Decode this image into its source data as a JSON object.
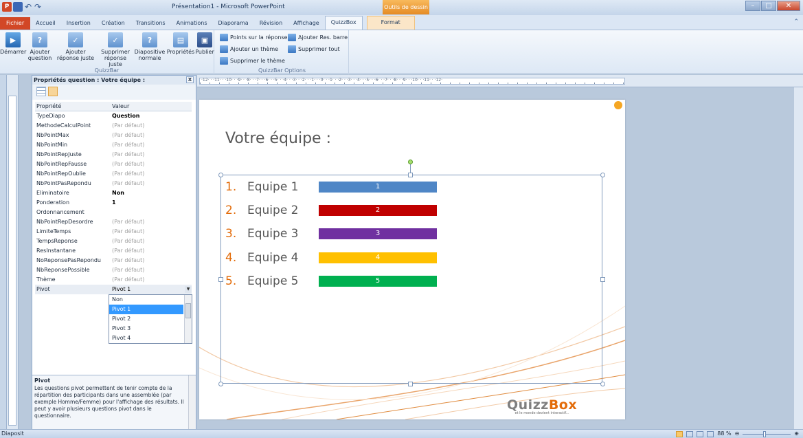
{
  "window": {
    "title": "Présentation1 - Microsoft PowerPoint",
    "contextual_tools": "Outils de dessin"
  },
  "ribbon_tabs": [
    {
      "label": "Fichier"
    },
    {
      "label": "Accueil"
    },
    {
      "label": "Insertion"
    },
    {
      "label": "Création"
    },
    {
      "label": "Transitions"
    },
    {
      "label": "Animations"
    },
    {
      "label": "Diaporama"
    },
    {
      "label": "Révision"
    },
    {
      "label": "Affichage"
    },
    {
      "label": "QuizzBox"
    },
    {
      "label": "Format"
    }
  ],
  "quizzbar": {
    "group_label": "QuizzBar",
    "buttons": [
      {
        "label": "Démarrer"
      },
      {
        "label": "Ajouter question"
      },
      {
        "label": "Ajouter réponse juste"
      },
      {
        "label": "Supprimer réponse juste"
      },
      {
        "label": "Diapositive normale"
      },
      {
        "label": "Propriétés"
      },
      {
        "label": "Publier"
      }
    ]
  },
  "quizzbar_options": {
    "group_label": "QuizzBar Options",
    "buttons": [
      {
        "label": "Points sur la réponse"
      },
      {
        "label": "Ajouter Res. barre"
      },
      {
        "label": "Ajouter un thème"
      },
      {
        "label": "Supprimer tout"
      },
      {
        "label": "Supprimer le thème"
      }
    ]
  },
  "properties_pane": {
    "title": "Propriétés question : Votre équipe :",
    "close_label": "X",
    "header": {
      "key": "Propriété",
      "value": "Valeur"
    },
    "rows": [
      {
        "key": "TypeDiapo",
        "value": "Question"
      },
      {
        "key": "MethodeCalculPoint",
        "value": "(Par défaut)"
      },
      {
        "key": "NbPointMax",
        "value": "(Par défaut)"
      },
      {
        "key": "NbPointMin",
        "value": "(Par défaut)"
      },
      {
        "key": "NbPointRepJuste",
        "value": "(Par défaut)"
      },
      {
        "key": "NbPointRepFausse",
        "value": "(Par défaut)"
      },
      {
        "key": "NbPointRepOublie",
        "value": "(Par défaut)"
      },
      {
        "key": "NbPointPasRepondu",
        "value": "(Par défaut)"
      },
      {
        "key": "Eliminatoire",
        "value": "Non"
      },
      {
        "key": "Ponderation",
        "value": "1"
      },
      {
        "key": "Ordonnancement",
        "value": ""
      },
      {
        "key": "NbPointRepDesordre",
        "value": "(Par défaut)"
      },
      {
        "key": "LimiteTemps",
        "value": "(Par défaut)"
      },
      {
        "key": "TempsReponse",
        "value": "(Par défaut)"
      },
      {
        "key": "ResInstantane",
        "value": "(Par défaut)"
      },
      {
        "key": "NoReponsePasRepondu",
        "value": "(Par défaut)"
      },
      {
        "key": "NbReponsePossible",
        "value": "(Par défaut)"
      },
      {
        "key": "Thème",
        "value": "(Par défaut)"
      },
      {
        "key": "Pivot",
        "value": "Pivot 1"
      }
    ],
    "dropdown_options": [
      "Non",
      "Pivot 1",
      "Pivot 2",
      "Pivot 3",
      "Pivot 4"
    ],
    "dropdown_selected": "Pivot 1",
    "description": {
      "title": "Pivot",
      "text": "Les questions pivot permettent de tenir compte de la répartition des participants dans une assemblée (par exemple Homme/Femme) pour l'affichage des résultats. Il peut y avoir plusieurs questions pivot dans le questionnaire."
    }
  },
  "ruler_text": "·12· · ·11· · ·10· · ·9· · ·8· · ·7· · ·6· · ·5· · ·4· · ·3· · ·2· · ·1· · ·0· · ·1· · ·2· · ·3· · ·4· · ·5· · ·6· · ·7· · ·8· · ·9· · ·10· · ·11· · ·12·",
  "slide": {
    "title": "Votre équipe :",
    "teams": [
      {
        "num": "1.",
        "name": "Equipe 1",
        "bar_label": "1",
        "color": "#4f86c6"
      },
      {
        "num": "2.",
        "name": "Equipe 2",
        "bar_label": "2",
        "color": "#c00000"
      },
      {
        "num": "3.",
        "name": "Equipe 3",
        "bar_label": "3",
        "color": "#7030a0"
      },
      {
        "num": "4.",
        "name": "Equipe 4",
        "bar_label": "4",
        "color": "#ffc000"
      },
      {
        "num": "5.",
        "name": "Equipe 5",
        "bar_label": "5",
        "color": "#00b050"
      }
    ],
    "logo_main": "Quizz",
    "logo_box": "Box",
    "logo_sub": "et le monde devient interactif..."
  },
  "statusbar": {
    "left": "Diaposit",
    "zoom": "88 %"
  }
}
